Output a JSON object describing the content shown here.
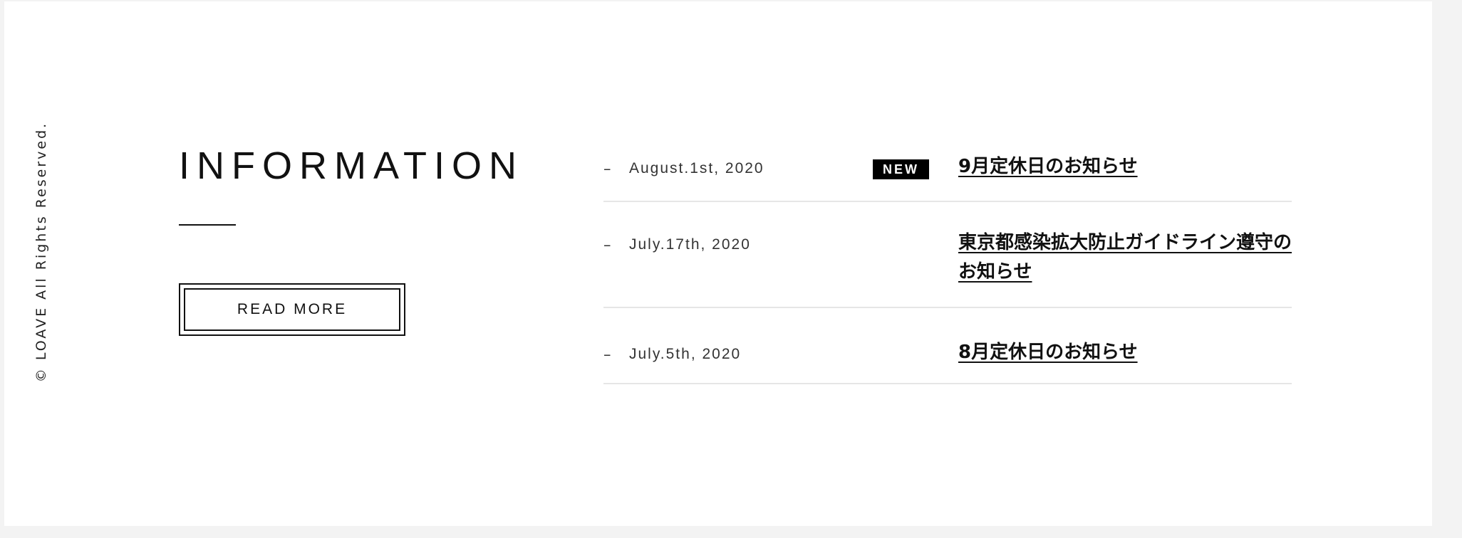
{
  "copyright": "© LOAVE All Rights Reserved.",
  "information": {
    "title": "INFORMATION",
    "read_more_label": "READ MORE"
  },
  "news": [
    {
      "dash": "–",
      "date": "August.1st, 2020",
      "badge": "NEW",
      "title": "9月定休日のお知らせ"
    },
    {
      "dash": "–",
      "date": "July.17th, 2020",
      "title": "東京都感染拡大防止ガイドライン遵守のお知らせ"
    },
    {
      "dash": "–",
      "date": "July.5th, 2020",
      "title": "8月定休日のお知らせ"
    }
  ],
  "colors": {
    "text": "#111111",
    "badge_background": "#000000",
    "badge_text": "#ffffff",
    "divider": "#e6e6e6",
    "page_background": "#ffffff",
    "outer_background": "#f3f3f3"
  }
}
